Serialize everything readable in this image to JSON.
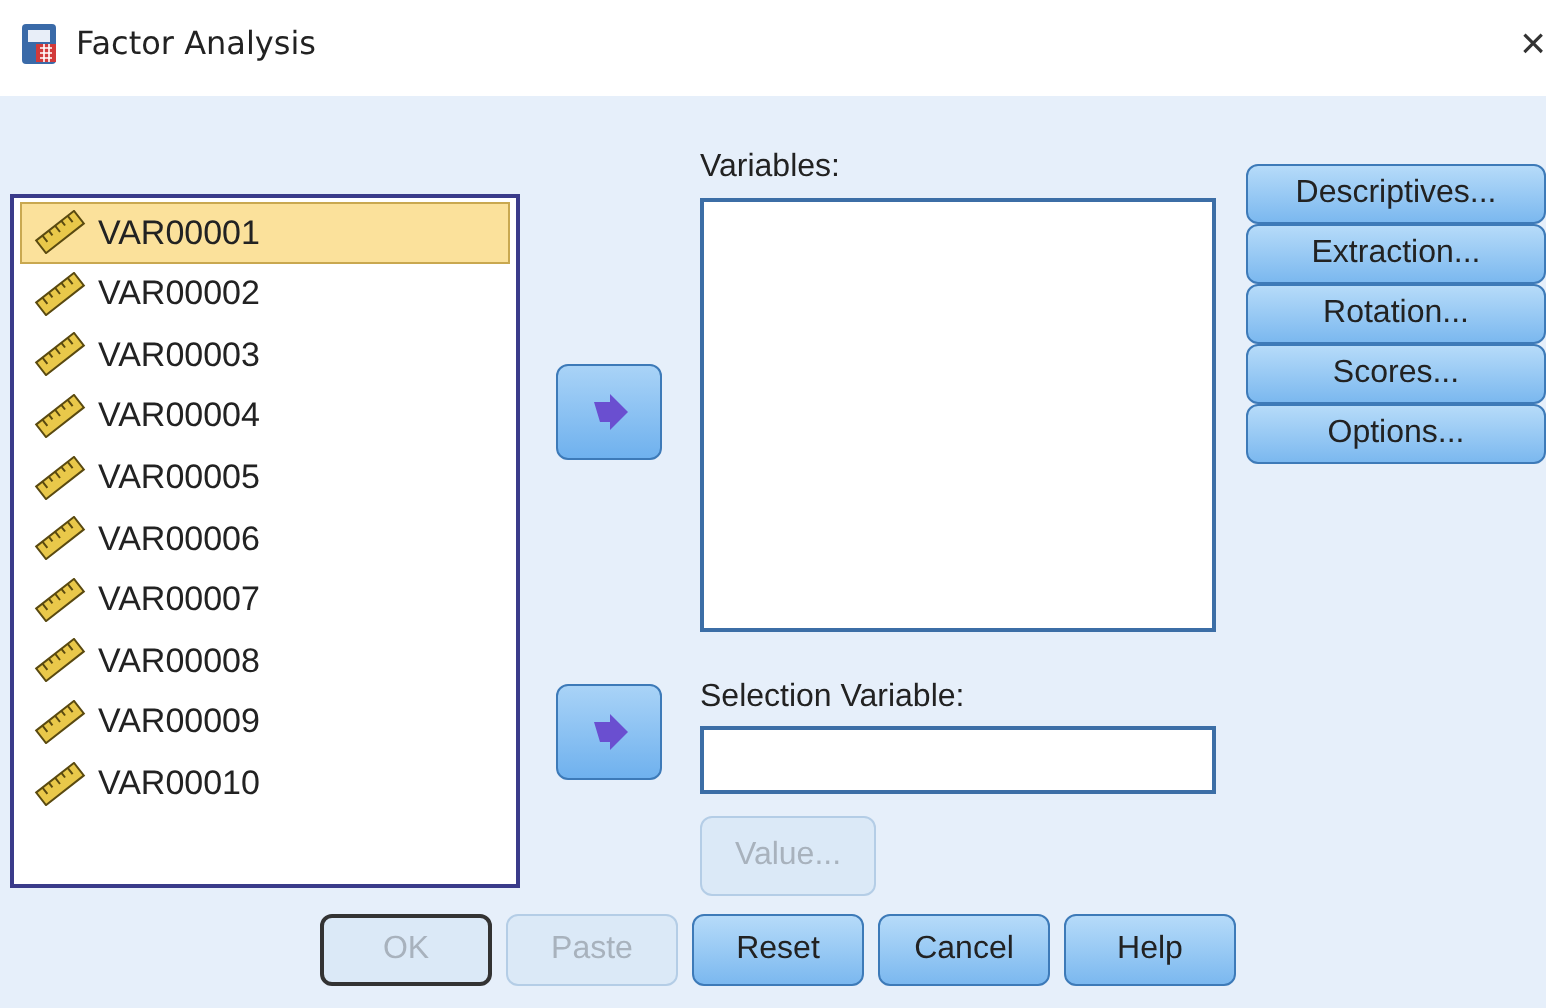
{
  "window": {
    "title": "Factor Analysis",
    "close": "×"
  },
  "source_list": {
    "items": [
      {
        "label": "VAR00001",
        "selected": true
      },
      {
        "label": "VAR00002",
        "selected": false
      },
      {
        "label": "VAR00003",
        "selected": false
      },
      {
        "label": "VAR00004",
        "selected": false
      },
      {
        "label": "VAR00005",
        "selected": false
      },
      {
        "label": "VAR00006",
        "selected": false
      },
      {
        "label": "VAR00007",
        "selected": false
      },
      {
        "label": "VAR00008",
        "selected": false
      },
      {
        "label": "VAR00009",
        "selected": false
      },
      {
        "label": "VAR00010",
        "selected": false
      }
    ]
  },
  "variables": {
    "label": "Variables:"
  },
  "selection_variable": {
    "label": "Selection Variable:",
    "value_button": {
      "label": "Value...",
      "disabled": true
    }
  },
  "side_buttons": [
    {
      "label": "Descriptives..."
    },
    {
      "label": "Extraction..."
    },
    {
      "label": "Rotation..."
    },
    {
      "label": "Scores..."
    },
    {
      "label": "Options..."
    }
  ],
  "footer_buttons": [
    {
      "label": "OK",
      "disabled": true,
      "default": true
    },
    {
      "label": "Paste",
      "disabled": true,
      "default": false
    },
    {
      "label": "Reset",
      "disabled": false,
      "default": false
    },
    {
      "label": "Cancel",
      "disabled": false,
      "default": false
    },
    {
      "label": "Help",
      "disabled": false,
      "default": false
    }
  ]
}
